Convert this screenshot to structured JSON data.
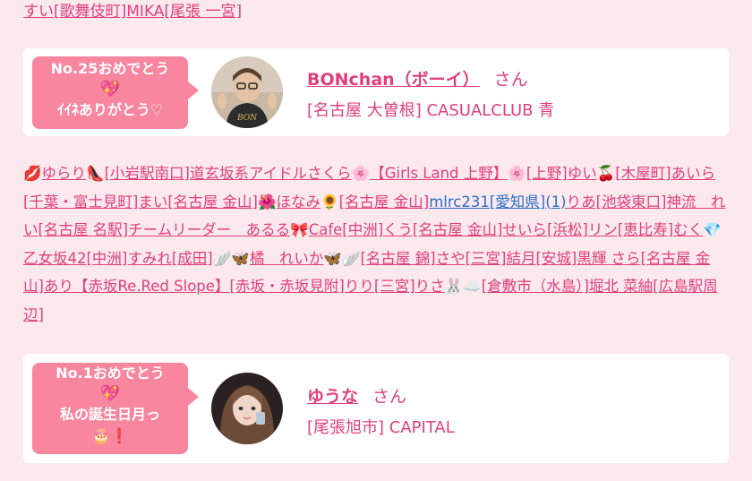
{
  "top_line": "すい[歌舞伎町]MIKA[尾張 一宮]",
  "card1": {
    "badge_line1": "No.25おめでとう",
    "badge_emoji": "💖",
    "badge_line2": "ｲｲﾈありがとう♡",
    "avatar_label": "BON",
    "name": "BONchan（ボーイ）",
    "san": "さん",
    "shop": "[名古屋 大曽根] CASUALCLUB 青"
  },
  "middle_segments": [
    {
      "t": "💋",
      "link": false
    },
    {
      "t": "ゆらり",
      "link": true
    },
    {
      "t": "👠",
      "link": false
    },
    {
      "t": "[小岩駅南口]",
      "link": true
    },
    {
      "t": "道玄坂系アイドルさくら",
      "link": true
    },
    {
      "t": "🌸",
      "link": false
    },
    {
      "t": "【Girls Land 上野】",
      "link": true
    },
    {
      "t": "🌸",
      "link": false
    },
    {
      "t": "[上野]",
      "link": true
    },
    {
      "t": "ゆい",
      "link": true
    },
    {
      "t": "🍒",
      "link": false
    },
    {
      "t": "[木屋町]",
      "link": true
    },
    {
      "t": "あいら",
      "link": true
    },
    {
      "t": "[千葉・富士見町]",
      "link": true
    },
    {
      "t": "まい",
      "link": true
    },
    {
      "t": "[名古屋 金山]",
      "link": true
    },
    {
      "t": "🌺",
      "link": false
    },
    {
      "t": "ほなみ",
      "link": true
    },
    {
      "t": "🌻",
      "link": false
    },
    {
      "t": "[名古屋 金山]",
      "link": true
    },
    {
      "t": "mlrc231",
      "link": true,
      "blue": true
    },
    {
      "t": "[愛知県]",
      "link": true,
      "blue": true
    },
    {
      "t": "(1)",
      "link": true,
      "blue": true
    },
    {
      "t": "りあ",
      "link": true
    },
    {
      "t": "[池袋東口]",
      "link": true
    },
    {
      "t": "神流　れい",
      "link": true
    },
    {
      "t": "[名古屋 名駅]",
      "link": true
    },
    {
      "t": "チームリーダー　あるる",
      "link": true
    },
    {
      "t": "🎀",
      "link": false
    },
    {
      "t": "Cafe",
      "link": true
    },
    {
      "t": "[中洲]",
      "link": true
    },
    {
      "t": "くう",
      "link": true
    },
    {
      "t": "[名古屋 金山]",
      "link": true
    },
    {
      "t": "せいら",
      "link": true
    },
    {
      "t": "[浜松]",
      "link": true
    },
    {
      "t": "リン",
      "link": true
    },
    {
      "t": "[恵比寿]",
      "link": true
    },
    {
      "t": "むく",
      "link": true
    },
    {
      "t": "💎",
      "link": false
    },
    {
      "t": "乙女坂42",
      "link": true
    },
    {
      "t": "[中洲]",
      "link": true
    },
    {
      "t": "すみれ",
      "link": true
    },
    {
      "t": "[成田]",
      "link": true
    },
    {
      "t": "🪽🦋",
      "link": false
    },
    {
      "t": "橘　れいか",
      "link": true
    },
    {
      "t": "🦋🪽",
      "link": false
    },
    {
      "t": "[名古屋 錦]",
      "link": true
    },
    {
      "t": "さや",
      "link": true
    },
    {
      "t": "[三宮]",
      "link": true
    },
    {
      "t": "結月",
      "link": true
    },
    {
      "t": "[安城]",
      "link": true
    },
    {
      "t": "黒輝 さら",
      "link": true
    },
    {
      "t": "[名古屋 金山]",
      "link": true
    },
    {
      "t": "あり",
      "link": true
    },
    {
      "t": "【赤坂Re.Red Slope】",
      "link": true
    },
    {
      "t": "[赤坂・赤坂見附]",
      "link": true
    },
    {
      "t": "りり",
      "link": true
    },
    {
      "t": "[三宮]",
      "link": true
    },
    {
      "t": "りさ",
      "link": true
    },
    {
      "t": "🐰☁️",
      "link": false
    },
    {
      "t": "[倉敷市（水島）]",
      "link": true
    },
    {
      "t": "堀北 菜紬",
      "link": true
    },
    {
      "t": "[広島駅周辺]",
      "link": true
    }
  ],
  "card2": {
    "badge_line1": "No.1おめでとう",
    "badge_emoji": "💖",
    "badge_line2": "私の誕生日月っ",
    "badge_line3": "🎂❗️",
    "name": "ゆうな",
    "san": "さん",
    "shop": "[尾張旭市] CAPITAL"
  },
  "colors": {
    "page_bg": "#fbe9ee",
    "accent": "#e0407a",
    "badge": "#f7869e",
    "link_blue": "#2a6fc9"
  }
}
